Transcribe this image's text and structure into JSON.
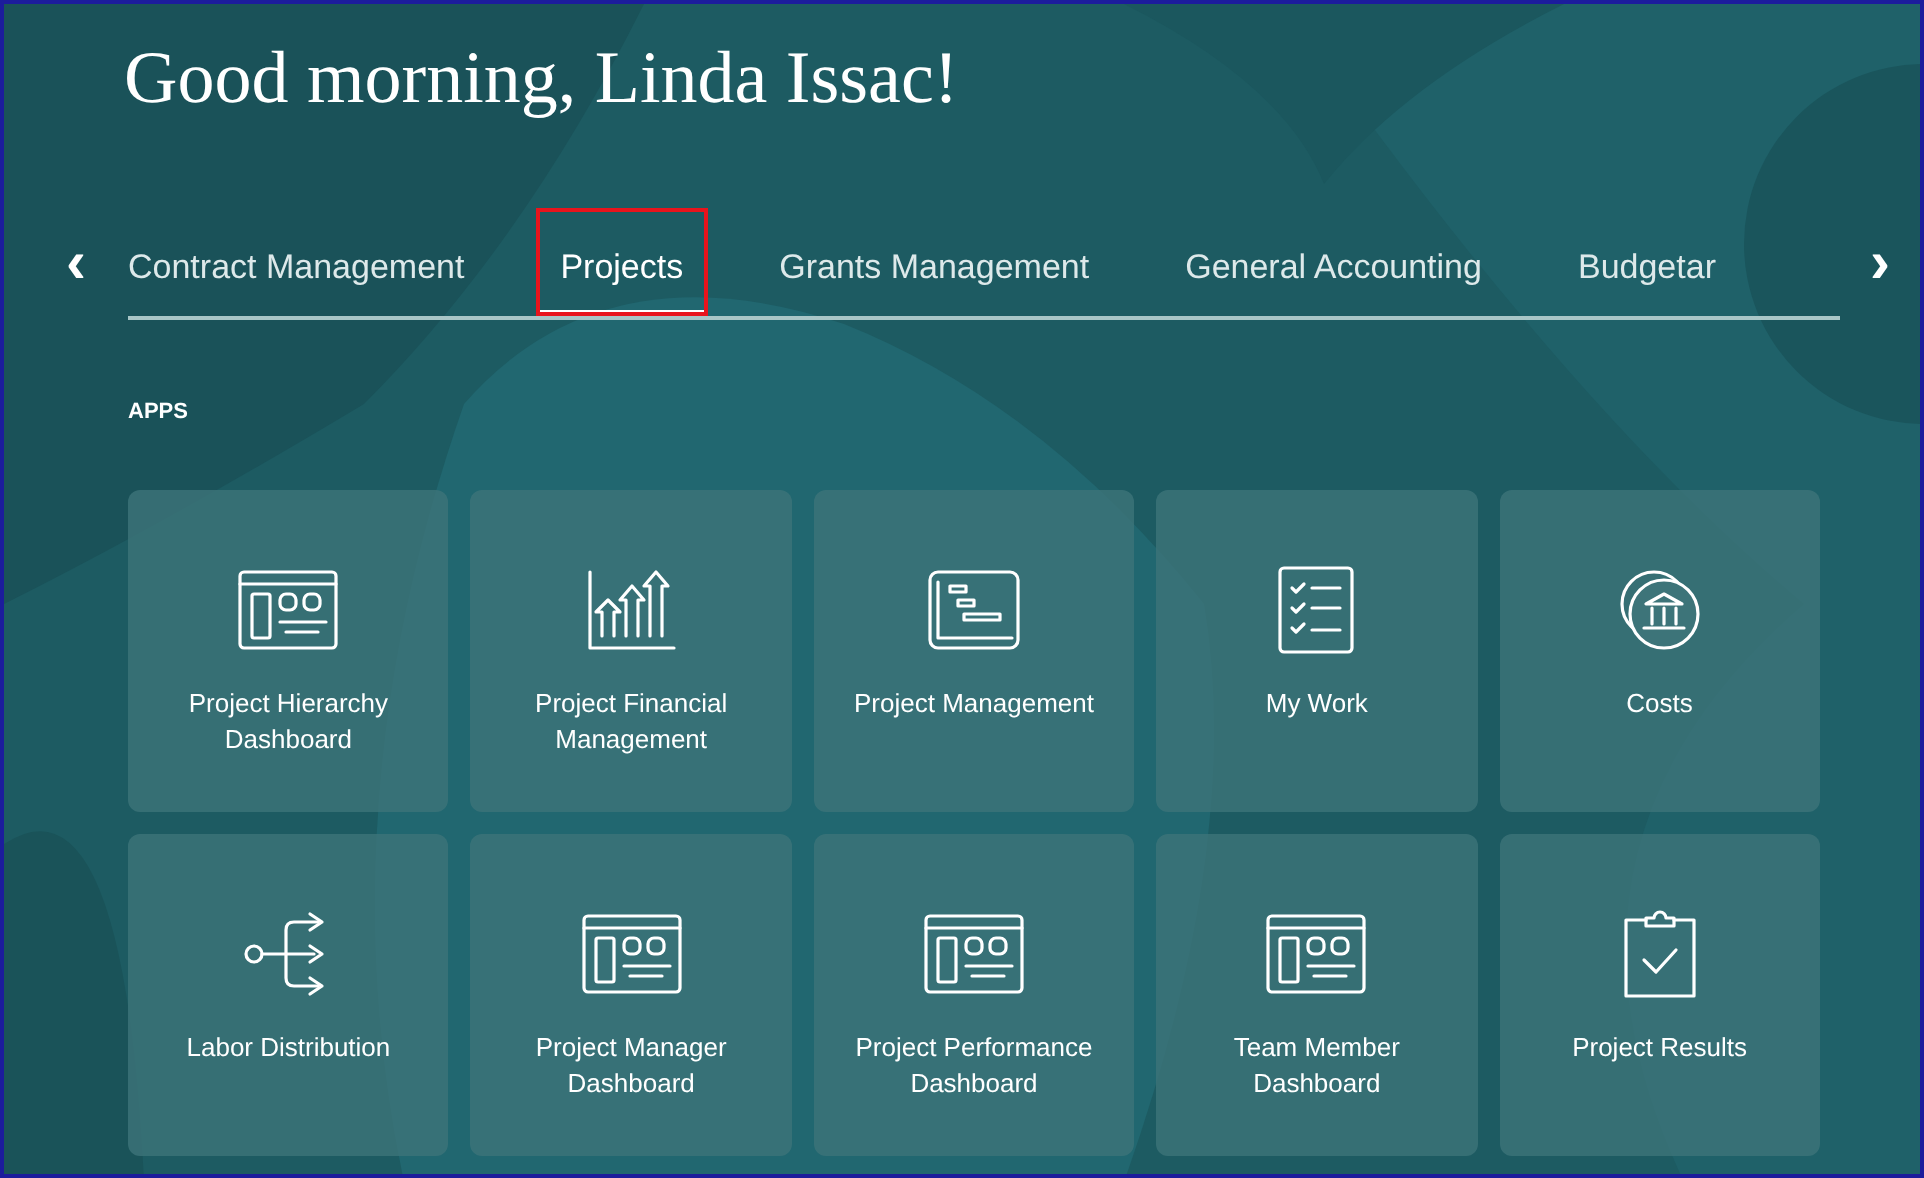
{
  "greeting": "Good morning, Linda Issac!",
  "nav": {
    "previous": "‹",
    "next": "›"
  },
  "tabs": [
    {
      "label": "Contract Management",
      "selected": false,
      "highlighted": false
    },
    {
      "label": "Projects",
      "selected": true,
      "highlighted": true
    },
    {
      "label": "Grants Management",
      "selected": false,
      "highlighted": false
    },
    {
      "label": "General Accounting",
      "selected": false,
      "highlighted": false
    },
    {
      "label": "Budgetar",
      "selected": false,
      "highlighted": false
    }
  ],
  "section_title": "APPS",
  "apps": [
    {
      "label": "Project Hierarchy Dashboard"
    },
    {
      "label": "Project Financial Management"
    },
    {
      "label": "Project Management"
    },
    {
      "label": "My Work"
    },
    {
      "label": "Costs"
    },
    {
      "label": "Labor Distribution"
    },
    {
      "label": "Project Manager Dashboard"
    },
    {
      "label": "Project Performance Dashboard"
    },
    {
      "label": "Team Member Dashboard"
    },
    {
      "label": "Project Results"
    }
  ]
}
